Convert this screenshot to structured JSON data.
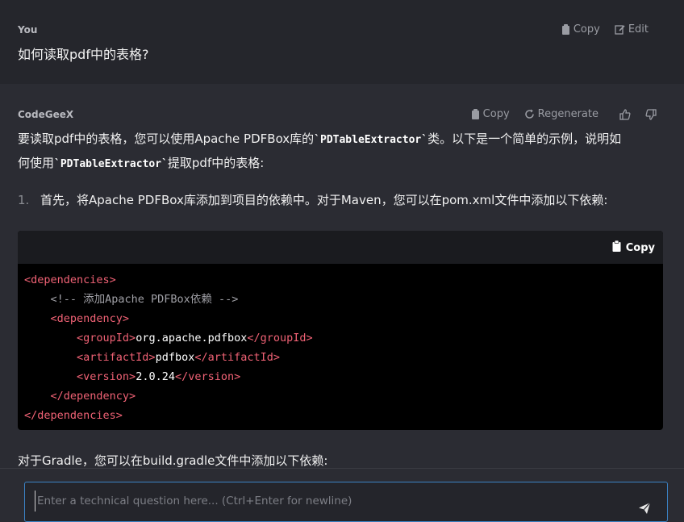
{
  "user": {
    "author": "You",
    "message": "如何读取pdf中的表格?",
    "copy_label": "Copy",
    "edit_label": "Edit"
  },
  "assistant": {
    "author": "CodeGeeX",
    "copy_label": "Copy",
    "regenerate_label": "Regenerate",
    "intro_1a": "要读取pdf中的表格，您可以使用Apache PDFBox库的",
    "intro_code": "`PDTableExtractor`",
    "intro_1b": "类。以下是一个简单的示例，说明如",
    "intro_2a": "何使用",
    "intro_2b": "提取pdf中的表格:",
    "list_item_1_num": "1.",
    "list_item_1": "首先，将Apache PDFBox库添加到项目的依赖中。对于Maven，您可以在pom.xml文件中添加以下依赖:",
    "code_copy_label": "Copy",
    "code": {
      "deps_open": "<dependencies>",
      "comment": "<!-- 添加Apache PDFBox依赖 -->",
      "dep_open": "<dependency>",
      "group_open": "<groupId>",
      "group_val": "org.apache.pdfbox",
      "group_close": "</groupId>",
      "artifact_open": "<artifactId>",
      "artifact_val": "pdfbox",
      "artifact_close": "</artifactId>",
      "version_open": "<version>",
      "version_val": "2.0.24",
      "version_close": "</version>",
      "dep_close": "</dependency>",
      "deps_close": "</dependencies>"
    },
    "gradle_text": "对于Gradle，您可以在build.gradle文件中添加以下依赖:"
  },
  "input": {
    "placeholder": "Enter a technical question here... (Ctrl+Enter for newline)",
    "value": ""
  }
}
